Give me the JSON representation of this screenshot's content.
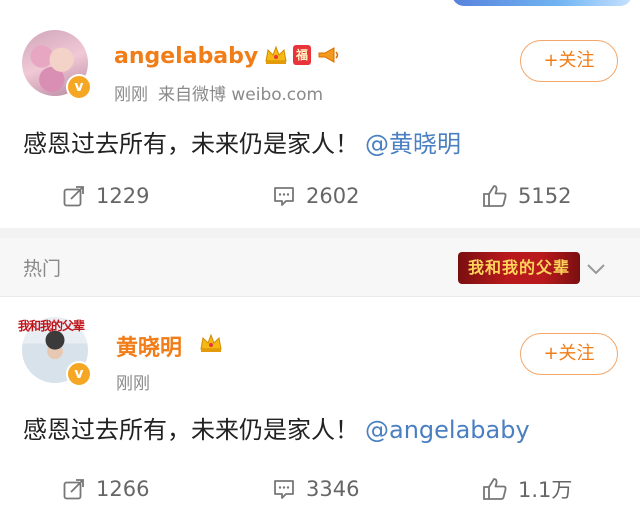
{
  "posts": [
    {
      "username": "angelababy",
      "time": "刚刚",
      "source": "来自微博 weibo.com",
      "follow_label": "+关注",
      "content": "感恩过去所有，未来仍是家人！",
      "mention": "@黄晓明",
      "badges": [
        "crown-icon",
        "fu-icon",
        "horn-icon"
      ],
      "fu_text": "福",
      "actions": {
        "reposts": "1229",
        "comments": "2602",
        "likes": "5152"
      }
    },
    {
      "username": "黄晓明",
      "time": "刚刚",
      "follow_label": "+关注",
      "content": "感恩过去所有，未来仍是家人！",
      "mention": "@angelababy",
      "badges": [
        "crown-icon"
      ],
      "avatar_tag": "我和我的父辈",
      "actions": {
        "reposts": "1266",
        "comments": "3346",
        "likes": "1.1万"
      }
    }
  ],
  "hot_section": {
    "label": "热门",
    "banner_text": "我和我的父辈"
  },
  "colors": {
    "username": "#f07d18",
    "mention": "#4a7fc1",
    "meta": "#8a8a8a",
    "verify_badge": "#f5a623"
  }
}
